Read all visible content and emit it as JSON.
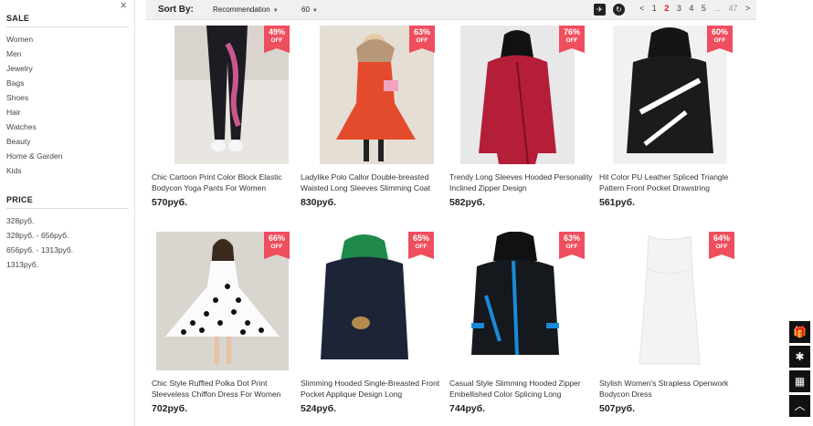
{
  "sidebar": {
    "close": "×",
    "sale_title": "SALE",
    "categories": [
      "Women",
      "Men",
      "Jewelry",
      "Bags",
      "Shoes",
      "Hair",
      "Watches",
      "Beauty",
      "Home & Garden",
      "Kids"
    ],
    "price_title": "PRICE",
    "prices": [
      "328руб.",
      "328руб. - 656руб.",
      "656руб. - 1313руб.",
      "1313руб."
    ]
  },
  "toolbar": {
    "sort_label": "Sort By:",
    "sort_value": "Recommendation",
    "per_page": "60",
    "pages": [
      "<",
      "1",
      "2",
      "3",
      "4",
      "5",
      "...",
      "47",
      ">"
    ],
    "active_page": "2"
  },
  "products": [
    {
      "pct": "49%",
      "off": "OFF",
      "title": "Chic Cartoon Print Color Block Elastic Bodycon Yoga Pants For Women",
      "price": "570руб."
    },
    {
      "pct": "63%",
      "off": "OFF",
      "title": "Ladylike Polo Callor Double-breasted Waisted Long Sleeves Slimming Coat",
      "price": "830руб."
    },
    {
      "pct": "76%",
      "off": "OFF",
      "title": "Trendy Long Sleeves Hooded Personality Inclined Zipper Design",
      "price": "582руб."
    },
    {
      "pct": "60%",
      "off": "OFF",
      "title": "Hit Color PU Leather Spliced Triangle Pattern Front Pocket Drawstring",
      "price": "561руб."
    },
    {
      "pct": "66%",
      "off": "OFF",
      "title": "Chic Style Ruffled Polka Dot Print Sleeveless Chiffon Dress For Women",
      "price": "702руб."
    },
    {
      "pct": "65%",
      "off": "OFF",
      "title": "Slimming Hooded Single-Breasted Front Pocket Applique Design Long",
      "price": "524руб."
    },
    {
      "pct": "63%",
      "off": "OFF",
      "title": "Casual Style Slimming Hooded Zipper Embellished Color Splicing Long",
      "price": "744руб."
    },
    {
      "pct": "64%",
      "off": "OFF",
      "title": "Stylish Women's Strapless Openwork Bodycon Dress",
      "price": "507руб."
    }
  ],
  "tools": [
    "gift-icon",
    "bug-icon",
    "qr-code-icon",
    "back-to-top-icon"
  ]
}
